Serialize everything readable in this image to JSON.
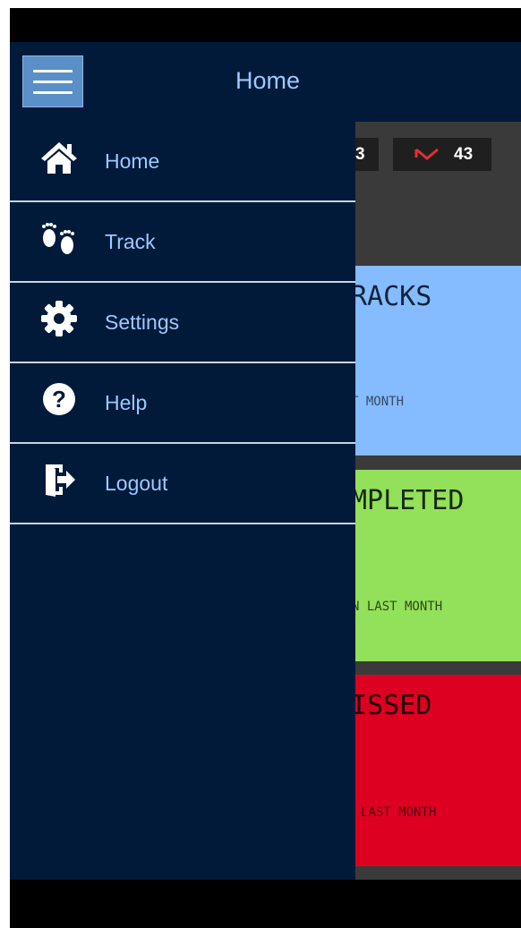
{
  "header": {
    "title": "Home"
  },
  "drawer": {
    "items": [
      {
        "label": "Home",
        "icon": "home-icon"
      },
      {
        "label": "Track",
        "icon": "footprints-icon"
      },
      {
        "label": "Settings",
        "icon": "gear-icon"
      },
      {
        "label": "Help",
        "icon": "question-icon"
      },
      {
        "label": "Logout",
        "icon": "logout-icon"
      }
    ]
  },
  "dashboard": {
    "stat_left": "3",
    "stat_right": "43",
    "cards": [
      {
        "title": "RACKS",
        "subtitle": "T MONTH",
        "color": "#84bcff"
      },
      {
        "title": "MPLETED",
        "subtitle": "N LAST MONTH",
        "color": "#93e05a"
      },
      {
        "title": "ISSED",
        "subtitle": "LAST MONTH",
        "color": "#de0020"
      }
    ]
  },
  "colors": {
    "primary": "#011a3a",
    "accent": "#9ec8ff",
    "menu_button": "#5a8fc7"
  }
}
